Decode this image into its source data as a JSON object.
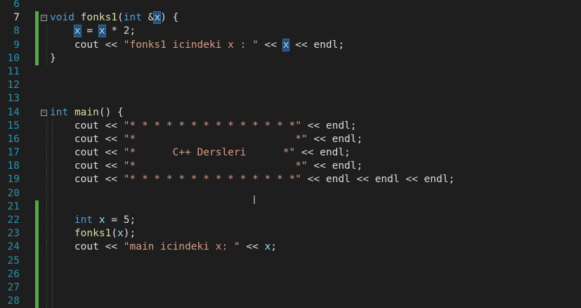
{
  "colors": {
    "background": "#1e1e1e",
    "line_number": "#2b91af",
    "keyword": "#569cd6",
    "function": "#dcdcaa",
    "string": "#d69d85",
    "identifier": "#9cdcfe",
    "change_bar": "#57a64a"
  },
  "lines": [
    {
      "n": "6",
      "tokens": []
    },
    {
      "n": "7",
      "fold": "⊟",
      "tokens": [
        {
          "t": "void",
          "c": "kw"
        },
        {
          "t": " "
        },
        {
          "t": "fonks1",
          "c": "fn"
        },
        {
          "t": "(",
          "c": "plain"
        },
        {
          "t": "int",
          "c": "kw"
        },
        {
          "t": " &",
          "c": "plain"
        },
        {
          "t": "x",
          "c": "hl"
        },
        {
          "t": ") {",
          "c": "plain"
        }
      ]
    },
    {
      "n": "8",
      "tokens": [
        {
          "t": "    "
        },
        {
          "t": "x",
          "c": "hl"
        },
        {
          "t": " = ",
          "c": "plain"
        },
        {
          "t": "x",
          "c": "hl"
        },
        {
          "t": " * 2;",
          "c": "plain"
        }
      ]
    },
    {
      "n": "9",
      "tokens": [
        {
          "t": "    "
        },
        {
          "t": "cout",
          "c": "plain"
        },
        {
          "t": " << ",
          "c": "plain"
        },
        {
          "t": "\"fonks1 icindeki x : \"",
          "c": "str"
        },
        {
          "t": " << ",
          "c": "plain"
        },
        {
          "t": "x",
          "c": "hl"
        },
        {
          "t": " << ",
          "c": "plain"
        },
        {
          "t": "endl",
          "c": "plain"
        },
        {
          "t": ";",
          "c": "plain"
        }
      ]
    },
    {
      "n": "10",
      "tokens": [
        {
          "t": "}",
          "c": "plain"
        }
      ]
    },
    {
      "n": "11",
      "tokens": []
    },
    {
      "n": "12",
      "tokens": []
    },
    {
      "n": "13",
      "tokens": []
    },
    {
      "n": "14",
      "fold": "⊟",
      "tokens": [
        {
          "t": "int",
          "c": "kw"
        },
        {
          "t": " "
        },
        {
          "t": "main",
          "c": "fn"
        },
        {
          "t": "() {",
          "c": "plain"
        }
      ]
    },
    {
      "n": "15",
      "tokens": [
        {
          "t": "    "
        },
        {
          "t": "cout",
          "c": "plain"
        },
        {
          "t": " << ",
          "c": "plain"
        },
        {
          "t": "\"* * * * * * * * * * * * * *\"",
          "c": "str"
        },
        {
          "t": " << ",
          "c": "plain"
        },
        {
          "t": "endl",
          "c": "plain"
        },
        {
          "t": ";",
          "c": "plain"
        }
      ]
    },
    {
      "n": "16",
      "tokens": [
        {
          "t": "    "
        },
        {
          "t": "cout",
          "c": "plain"
        },
        {
          "t": " << ",
          "c": "plain"
        },
        {
          "t": "\"*                          *\"",
          "c": "str"
        },
        {
          "t": " << ",
          "c": "plain"
        },
        {
          "t": "endl",
          "c": "plain"
        },
        {
          "t": ";",
          "c": "plain"
        }
      ]
    },
    {
      "n": "17",
      "tokens": [
        {
          "t": "    "
        },
        {
          "t": "cout",
          "c": "plain"
        },
        {
          "t": " << ",
          "c": "plain"
        },
        {
          "t": "\"*      C++ Dersleri      *\"",
          "c": "str"
        },
        {
          "t": " << ",
          "c": "plain"
        },
        {
          "t": "endl",
          "c": "plain"
        },
        {
          "t": ";",
          "c": "plain"
        }
      ]
    },
    {
      "n": "18",
      "tokens": [
        {
          "t": "    "
        },
        {
          "t": "cout",
          "c": "plain"
        },
        {
          "t": " << ",
          "c": "plain"
        },
        {
          "t": "\"*                          *\"",
          "c": "str"
        },
        {
          "t": " << ",
          "c": "plain"
        },
        {
          "t": "endl",
          "c": "plain"
        },
        {
          "t": ";",
          "c": "plain"
        }
      ]
    },
    {
      "n": "19",
      "tokens": [
        {
          "t": "    "
        },
        {
          "t": "cout",
          "c": "plain"
        },
        {
          "t": " << ",
          "c": "plain"
        },
        {
          "t": "\"* * * * * * * * * * * * * *\"",
          "c": "str"
        },
        {
          "t": " << ",
          "c": "plain"
        },
        {
          "t": "endl",
          "c": "plain"
        },
        {
          "t": " << ",
          "c": "plain"
        },
        {
          "t": "endl",
          "c": "plain"
        },
        {
          "t": " << ",
          "c": "plain"
        },
        {
          "t": "endl",
          "c": "plain"
        },
        {
          "t": ";",
          "c": "plain"
        }
      ]
    },
    {
      "n": "20",
      "tokens": []
    },
    {
      "n": "21",
      "tokens": []
    },
    {
      "n": "22",
      "tokens": [
        {
          "t": "    "
        },
        {
          "t": "int",
          "c": "kw"
        },
        {
          "t": " "
        },
        {
          "t": "x",
          "c": "id"
        },
        {
          "t": " = ",
          "c": "plain"
        },
        {
          "t": "5",
          "c": "plain"
        },
        {
          "t": ";",
          "c": "plain"
        }
      ]
    },
    {
      "n": "23",
      "tokens": [
        {
          "t": "    "
        },
        {
          "t": "fonks1",
          "c": "fn"
        },
        {
          "t": "(",
          "c": "plain"
        },
        {
          "t": "x",
          "c": "id"
        },
        {
          "t": ");",
          "c": "plain"
        }
      ]
    },
    {
      "n": "24",
      "tokens": [
        {
          "t": "    "
        },
        {
          "t": "cout",
          "c": "plain"
        },
        {
          "t": " << ",
          "c": "plain"
        },
        {
          "t": "\"main icindeki x: \"",
          "c": "str"
        },
        {
          "t": " << ",
          "c": "plain"
        },
        {
          "t": "x",
          "c": "id"
        },
        {
          "t": ";",
          "c": "plain"
        }
      ]
    },
    {
      "n": "25",
      "tokens": []
    },
    {
      "n": "26",
      "tokens": []
    },
    {
      "n": "27",
      "tokens": []
    },
    {
      "n": "28",
      "tokens": []
    }
  ]
}
